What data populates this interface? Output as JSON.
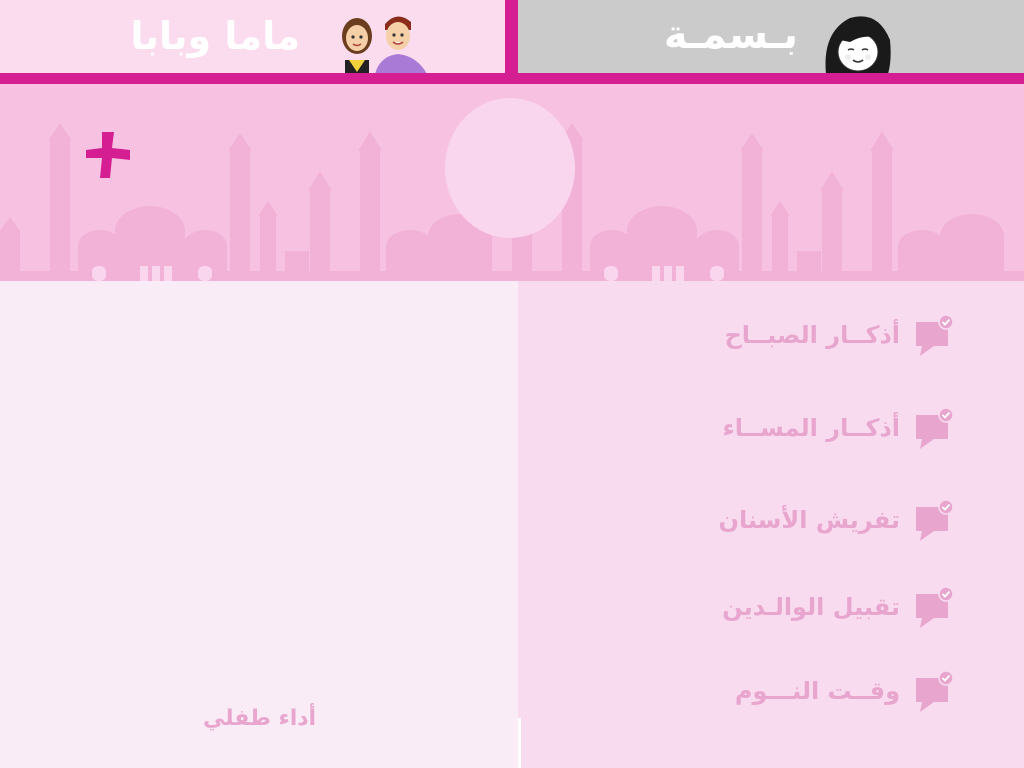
{
  "tabs": {
    "left": {
      "label": "ماما وبابا",
      "icon": "parents-icon",
      "active": true
    },
    "right": {
      "label": "بـسمـة",
      "icon": "girl-avatar-icon",
      "active": false
    }
  },
  "banner": {
    "add_icon": "plus-icon",
    "avatar": "profile-photo-placeholder"
  },
  "menu": {
    "items": [
      {
        "label": "أذكــار الصبــاح",
        "icon": "speech-bubble-check-icon"
      },
      {
        "label": "أذكــار المســاء",
        "icon": "speech-bubble-check-icon"
      },
      {
        "label": "تفريش الأسنان",
        "icon": "speech-bubble-check-icon"
      },
      {
        "label": "تقبيل الوالـدين",
        "icon": "speech-bubble-check-icon"
      },
      {
        "label": "وقــت النـــوم",
        "icon": "speech-bubble-check-icon"
      }
    ]
  },
  "footer": {
    "label": "أداء طفلي"
  },
  "colors": {
    "accent": "#d61e93",
    "banner": "#f7c2e2",
    "menu_text": "#e8a6cf",
    "tab_inactive": "#cbcbcb"
  }
}
